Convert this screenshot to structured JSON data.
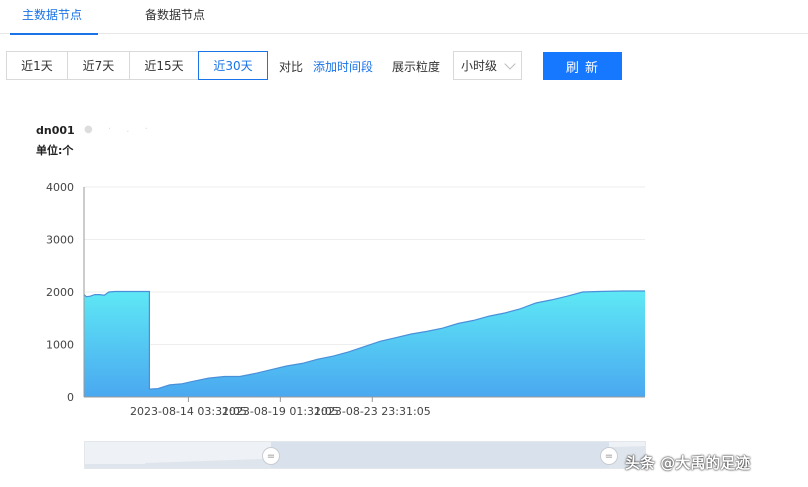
{
  "tabs": [
    {
      "label": "主数据节点"
    },
    {
      "label": "备数据节点"
    }
  ],
  "toolbar": {
    "ranges": [
      {
        "label": "近1天"
      },
      {
        "label": "近7天"
      },
      {
        "label": "近15天"
      },
      {
        "label": "近30天"
      }
    ],
    "active_range": "近30天",
    "compare_label": "对比",
    "add_period_link": "添加时间段",
    "granularity_label": "展示粒度",
    "granularity_value": "小时级",
    "refresh_label": "刷 新"
  },
  "chart_header": {
    "series_name": "dn001",
    "unit_label": "单位:个"
  },
  "colors": {
    "accent": "#1677ff",
    "area_top": "#5ee8f5",
    "area_bottom": "#4aa8f0",
    "line": "#4a90d9"
  },
  "chart_data": {
    "type": "area",
    "yticks": [
      "0",
      "1000",
      "2000",
      "3000",
      "4000"
    ],
    "ylim": [
      0,
      4000
    ],
    "xticks": [
      "2023-08-14 03:31:05",
      "2023-08-19 01:31:05",
      "2023-08-23 23:31:05"
    ],
    "xlim_hours": [
      0,
      720
    ],
    "points": [
      [
        0,
        1950
      ],
      [
        3,
        1910
      ],
      [
        8,
        1920
      ],
      [
        14,
        1950
      ],
      [
        20,
        1950
      ],
      [
        26,
        1940
      ],
      [
        32,
        2000
      ],
      [
        40,
        2010
      ],
      [
        60,
        2010
      ],
      [
        84,
        2010
      ],
      [
        84,
        150
      ],
      [
        95,
        160
      ],
      [
        110,
        230
      ],
      [
        125,
        250
      ],
      [
        140,
        300
      ],
      [
        160,
        360
      ],
      [
        180,
        390
      ],
      [
        200,
        390
      ],
      [
        220,
        450
      ],
      [
        240,
        520
      ],
      [
        260,
        590
      ],
      [
        280,
        640
      ],
      [
        300,
        720
      ],
      [
        320,
        780
      ],
      [
        340,
        860
      ],
      [
        360,
        960
      ],
      [
        380,
        1060
      ],
      [
        400,
        1130
      ],
      [
        420,
        1200
      ],
      [
        440,
        1250
      ],
      [
        460,
        1310
      ],
      [
        480,
        1400
      ],
      [
        500,
        1460
      ],
      [
        520,
        1540
      ],
      [
        540,
        1600
      ],
      [
        560,
        1680
      ],
      [
        580,
        1790
      ],
      [
        600,
        1850
      ],
      [
        620,
        1920
      ],
      [
        640,
        2000
      ],
      [
        660,
        2010
      ],
      [
        690,
        2020
      ],
      [
        720,
        2020
      ]
    ]
  },
  "watermark": "头条 @大禹的足迹"
}
